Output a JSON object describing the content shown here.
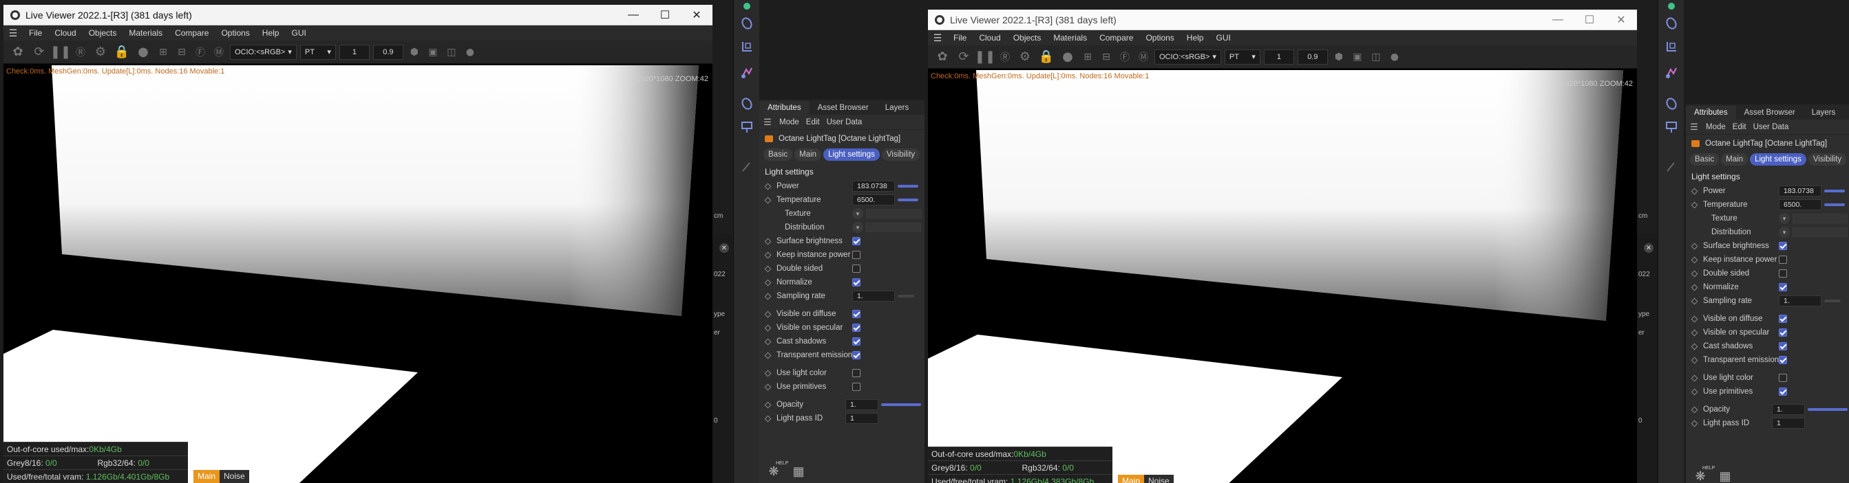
{
  "screens": [
    {
      "window_title": "Live Viewer 2022.1-[R3] (381 days left)",
      "menu": [
        "File",
        "Cloud",
        "Objects",
        "Materials",
        "Compare",
        "Options",
        "Help",
        "GUI"
      ],
      "toolbar": {
        "ocio": "OCIO:<sRGB>",
        "mode": "PT",
        "num1": "1",
        "num2": "0.9"
      },
      "stats": "Check:0ms. MeshGen:0ms. Update[L]:0ms. Nodes:16 Movable:1",
      "resolution": "1920*1080 ZOOM:42",
      "memory": {
        "out_of_core_label": "Out-of-core used/max:",
        "out_of_core_value": "0Kb/4Gb",
        "grey_label": "Grey8/16: ",
        "grey_value": "0/0",
        "rgb_label": "Rgb32/64: ",
        "rgb_value": "0/0",
        "vram_label": "Used/free/total vram: ",
        "vram_value": "1.126Gb/4.401Gb/8Gb"
      },
      "tabs": {
        "main": "Main",
        "noise": "Noise"
      },
      "bg_labels": {
        "cm": "cm",
        "yr": "022",
        "type": "ype",
        "er": "er",
        "n": "0"
      },
      "attributes": {
        "tabs": [
          "Attributes",
          "Asset Browser",
          "Layers"
        ],
        "menu": [
          "Mode",
          "Edit",
          "User Data"
        ],
        "object": "Octane LightTag [Octane LightTag]",
        "subtabs": [
          "Basic",
          "Main",
          "Light settings",
          "Visibility"
        ],
        "section": "Light settings",
        "power_label": "Power",
        "power_value": "183.0738",
        "temperature_label": "Temperature",
        "temperature_value": "6500.",
        "texture_label": "Texture",
        "distribution_label": "Distribution",
        "surface_brightness_label": "Surface brightness",
        "keep_instance_power_label": "Keep instance power",
        "double_sided_label": "Double sided",
        "normalize_label": "Normalize",
        "sampling_rate_label": "Sampling rate",
        "sampling_rate_value": "1.",
        "visible_on_diffuse_label": "Visible on diffuse",
        "visible_on_specular_label": "Visible on specular",
        "cast_shadows_label": "Cast shadows",
        "transparent_emission_label": "Transparent emission",
        "use_light_color_label": "Use light color",
        "use_primitives_label": "Use primitives",
        "opacity_label": "Opacity",
        "opacity_value": "1.",
        "light_pass_id_label": "Light pass ID",
        "light_pass_id_value": "1",
        "help_label": "HELP"
      },
      "checks": {
        "surface_brightness": true,
        "keep_instance_power": false,
        "double_sided": false,
        "normalize": true,
        "visible_on_diffuse": true,
        "visible_on_specular": true,
        "cast_shadows": true,
        "transparent_emission": true,
        "use_light_color": false,
        "use_primitives": false
      }
    },
    {
      "window_title": "Live Viewer 2022.1-[R3] (381 days left)",
      "menu": [
        "File",
        "Cloud",
        "Objects",
        "Materials",
        "Compare",
        "Options",
        "Help",
        "GUI"
      ],
      "toolbar": {
        "ocio": "OCIO:<sRGB>",
        "mode": "PT",
        "num1": "1",
        "num2": "0.9"
      },
      "stats": "Check:0ms. MeshGen:0ms. Update[L]:0ms. Nodes:16 Movable:1",
      "resolution": "1920*1080 ZOOM:42",
      "memory": {
        "out_of_core_label": "Out-of-core used/max:",
        "out_of_core_value": "0Kb/4Gb",
        "grey_label": "Grey8/16: ",
        "grey_value": "0/0",
        "rgb_label": "Rgb32/64: ",
        "rgb_value": "0/0",
        "vram_label": "Used/free/total vram: ",
        "vram_value": "1.126Gb/4.383Gb/8Gb"
      },
      "tabs": {
        "main": "Main",
        "noise": "Noise"
      },
      "bg_labels": {
        "cm": "cm",
        "yr": "022",
        "type": "ype",
        "er": "er",
        "n": "0"
      },
      "attributes": {
        "tabs": [
          "Attributes",
          "Asset Browser",
          "Layers"
        ],
        "menu": [
          "Mode",
          "Edit",
          "User Data"
        ],
        "object": "Octane LightTag [Octane LightTag]",
        "subtabs": [
          "Basic",
          "Main",
          "Light settings",
          "Visibility"
        ],
        "section": "Light settings",
        "power_label": "Power",
        "power_value": "183.0738",
        "temperature_label": "Temperature",
        "temperature_value": "6500.",
        "texture_label": "Texture",
        "distribution_label": "Distribution",
        "surface_brightness_label": "Surface brightness",
        "keep_instance_power_label": "Keep instance power",
        "double_sided_label": "Double sided",
        "normalize_label": "Normalize",
        "sampling_rate_label": "Sampling rate",
        "sampling_rate_value": "1.",
        "visible_on_diffuse_label": "Visible on diffuse",
        "visible_on_specular_label": "Visible on specular",
        "cast_shadows_label": "Cast shadows",
        "transparent_emission_label": "Transparent emission",
        "use_light_color_label": "Use light color",
        "use_primitives_label": "Use primitives",
        "opacity_label": "Opacity",
        "opacity_value": "1.",
        "light_pass_id_label": "Light pass ID",
        "light_pass_id_value": "1",
        "help_label": "HELP"
      },
      "checks": {
        "surface_brightness": true,
        "keep_instance_power": false,
        "double_sided": false,
        "normalize": true,
        "visible_on_diffuse": true,
        "visible_on_specular": true,
        "cast_shadows": true,
        "transparent_emission": true,
        "use_light_color": false,
        "use_primitives": true
      }
    }
  ]
}
